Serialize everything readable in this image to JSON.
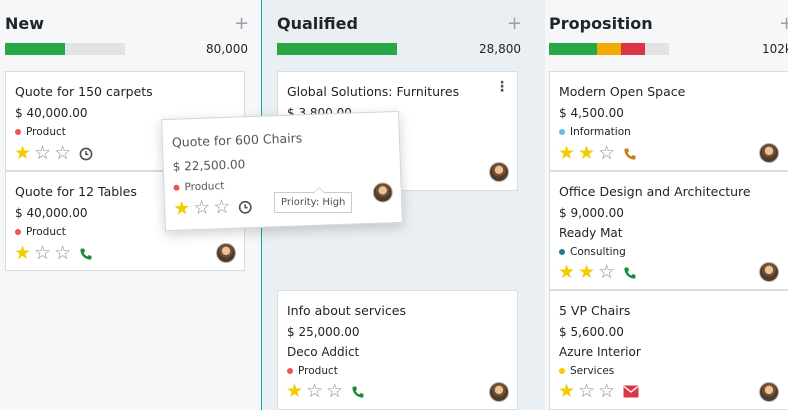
{
  "colors": {
    "green": "#28a745",
    "orange": "#f0ad00",
    "red": "#dc3545",
    "grey": "#e2e3e5",
    "star_on": "#f3cc00",
    "tag_product": "#e8554e",
    "tag_information": "#6cb8e6",
    "tag_consulting": "#1b7f8e",
    "tag_services": "#f3cc00",
    "phone": "#1a8a3c",
    "phone_orange": "#c57b1f",
    "mail": "#dc3545"
  },
  "columns": [
    {
      "title": "New",
      "total": "80,000",
      "progress": [
        {
          "color": "#28a745",
          "fraction": 0.5
        }
      ],
      "cards": [
        {
          "title": "Quote for 150 carpets",
          "amount": "$ 40,000.00",
          "tag": "Product",
          "tag_color": "#e8554e",
          "stars": 1,
          "activity": "clock-icon",
          "avatar": false
        },
        {
          "title": "Quote for 12 Tables",
          "amount": "$ 40,000.00",
          "tag": "Product",
          "tag_color": "#e8554e",
          "stars": 1,
          "activity": "phone-icon",
          "avatar": true
        }
      ]
    },
    {
      "title": "Qualified",
      "total": "28,800",
      "progress": [
        {
          "color": "#28a745",
          "fraction": 1.0
        }
      ],
      "cards": [
        {
          "title": "Global Solutions: Furnitures",
          "amount": "$ 3,800.00",
          "stars": 0,
          "avatar": true
        },
        {
          "title": "Info about services",
          "amount": "$ 25,000.00",
          "customer": "Deco Addict",
          "tag": "Product",
          "tag_color": "#e8554e",
          "stars": 1,
          "activity": "phone-icon",
          "avatar": true
        }
      ]
    },
    {
      "title": "Proposition",
      "total": "102k",
      "progress": [
        {
          "color": "#28a745",
          "fraction": 0.4
        },
        {
          "color": "#f0ad00",
          "fraction": 0.2
        },
        {
          "color": "#dc3545",
          "fraction": 0.2
        }
      ],
      "cards": [
        {
          "title": "Modern Open Space",
          "amount": "$ 4,500.00",
          "tag": "Information",
          "tag_color": "#6cb8e6",
          "stars": 2,
          "activity": "phone-icon",
          "avatar": true
        },
        {
          "title": "Office Design and Architecture",
          "amount": "$ 9,000.00",
          "customer": "Ready Mat",
          "tag": "Consulting",
          "tag_color": "#1b7f8e",
          "stars": 2,
          "activity": "phone-icon",
          "avatar": true
        },
        {
          "title": "5 VP Chairs",
          "amount": "$ 5,600.00",
          "customer": "Azure Interior",
          "tag": "Services",
          "tag_color": "#f3cc00",
          "stars": 1,
          "activity": "mail-icon",
          "avatar": true
        }
      ]
    }
  ],
  "dragged_card": {
    "title": "Quote for 600 Chairs",
    "amount": "$ 22,500.00",
    "tag": "Product",
    "tag_color": "#e8554e",
    "stars": 1,
    "activity": "clock-icon",
    "tooltip": "Priority: High"
  },
  "add_symbol": "+",
  "kebab_symbol": "⋮"
}
